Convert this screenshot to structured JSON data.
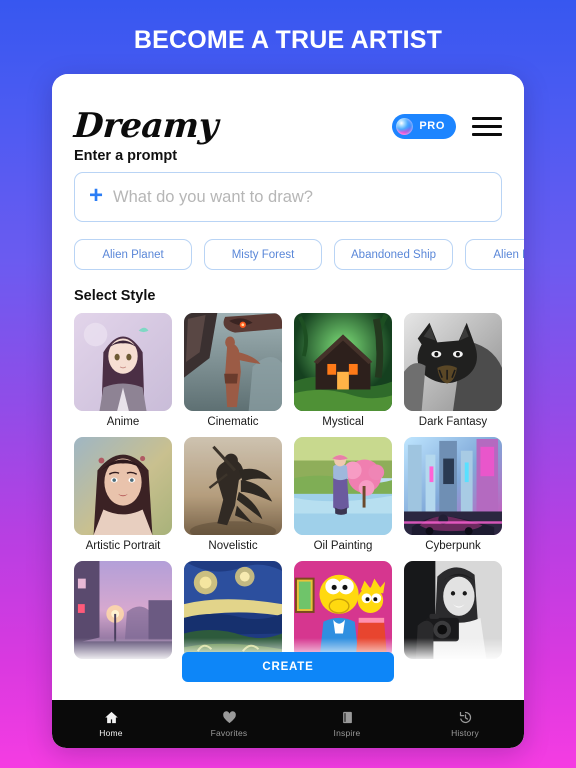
{
  "promo": {
    "title": "BECOME A TRUE ARTIST"
  },
  "header": {
    "logo": "Dreamy",
    "pro_label": "PRO",
    "pro_icon": "gradient-orb-icon",
    "menu_icon": "hamburger-menu-icon"
  },
  "prompt": {
    "label": "Enter a prompt",
    "placeholder": "What do you want to draw?",
    "value": "",
    "add_icon": "plus-icon"
  },
  "suggestions": [
    {
      "label": "Alien Planet"
    },
    {
      "label": "Misty Forest"
    },
    {
      "label": "Abandoned Ship"
    },
    {
      "label": "Alien Planet"
    }
  ],
  "styles": {
    "title": "Select Style",
    "items": [
      {
        "label": "Anime"
      },
      {
        "label": "Cinematic"
      },
      {
        "label": "Mystical"
      },
      {
        "label": "Dark Fantasy"
      },
      {
        "label": "Artistic Portrait"
      },
      {
        "label": "Novelistic"
      },
      {
        "label": "Oil Painting"
      },
      {
        "label": "Cyberpunk"
      },
      {
        "label": ""
      },
      {
        "label": ""
      },
      {
        "label": ""
      },
      {
        "label": ""
      }
    ]
  },
  "create_button": {
    "label": "CREATE"
  },
  "bottom_nav": [
    {
      "label": "Home",
      "icon": "home-icon",
      "active": true
    },
    {
      "label": "Favorites",
      "icon": "heart-icon",
      "active": false
    },
    {
      "label": "Inspire",
      "icon": "book-icon",
      "active": false
    },
    {
      "label": "History",
      "icon": "clock-rewind-icon",
      "active": false
    }
  ],
  "colors": {
    "bg_top": "#3757f0",
    "bg_bottom": "#f53ce2",
    "accent_blue": "#0d86f8",
    "chip_border": "#b9d4f5",
    "chip_text": "#5a87d8",
    "nav_bg": "#0a0a0a"
  }
}
